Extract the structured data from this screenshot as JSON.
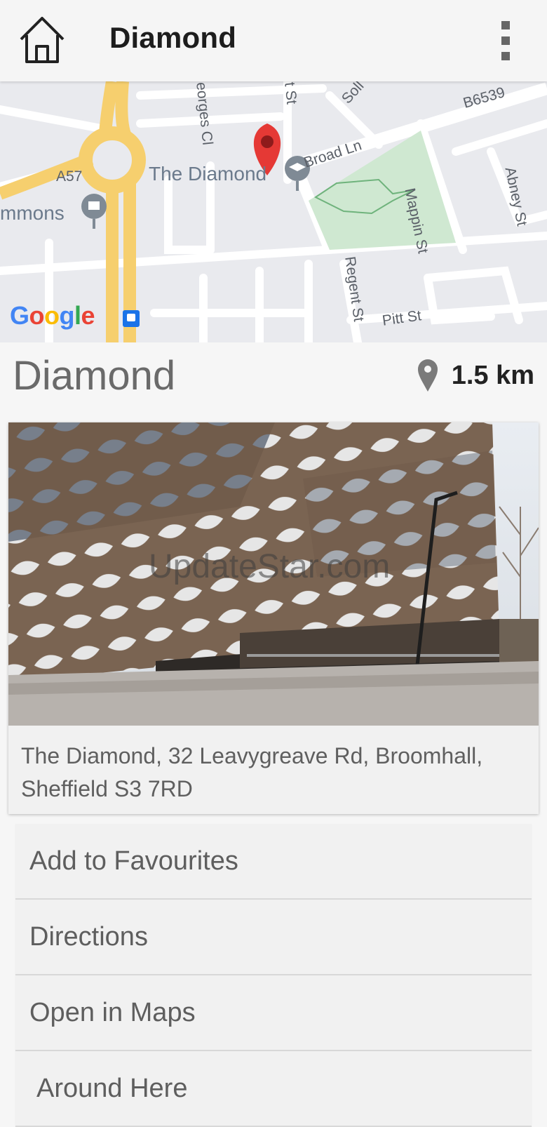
{
  "appbar": {
    "title": "Diamond",
    "home_icon": "home-icon",
    "menu_icon": "more-vert-icon"
  },
  "map": {
    "labels": {
      "b6539": "B6539",
      "broad_ln": "Broad Ln",
      "a57": "A57",
      "the_diamond": "The Diamond",
      "commons": "mmons",
      "mappin_st": "Mappin St",
      "abney_st": "Abney St",
      "regent_st": "Regent St",
      "pitt_st": "Pitt St",
      "georges_cl": "eorges Cl",
      "st_top": "t St",
      "solly": "Soll"
    },
    "attribution": "Google",
    "colors": {
      "road_major": "#f6cf6e",
      "park": "#cfe8d1",
      "marker": "#e53935"
    }
  },
  "place": {
    "name": "Diamond",
    "distance": "1.5 km"
  },
  "card": {
    "watermark": "UpdateStar.com",
    "address": "The Diamond, 32 Leavygreave Rd, Broomhall, Sheffield S3 7RD"
  },
  "actions": [
    {
      "label": "Add to Favourites"
    },
    {
      "label": "Directions"
    },
    {
      "label": "Open in Maps"
    },
    {
      "label": "Around Here"
    }
  ]
}
